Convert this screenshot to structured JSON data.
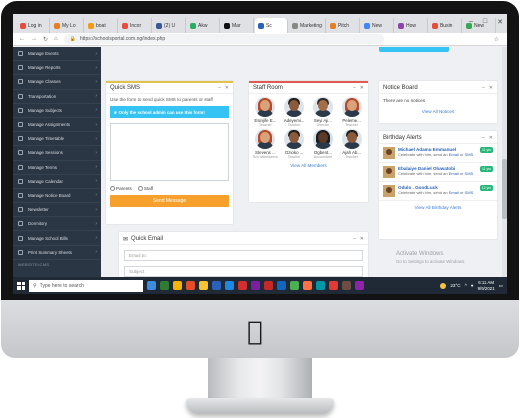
{
  "browser": {
    "tabs": [
      {
        "label": "Log in",
        "color": "#e74c3c"
      },
      {
        "label": "My Lo",
        "color": "#e67e22"
      },
      {
        "label": "boat",
        "color": "#f39c12"
      },
      {
        "label": "Incor",
        "color": "#e74c3c"
      },
      {
        "label": "(2) U",
        "color": "#3b5998"
      },
      {
        "label": "Akw",
        "color": "#27ae60"
      },
      {
        "label": "Mar",
        "color": "#111111"
      },
      {
        "label": "Sc",
        "color": "#2a62b9",
        "active": true
      },
      {
        "label": "Marketing",
        "color": "#888888"
      },
      {
        "label": "Pitch",
        "color": "#e67e22"
      },
      {
        "label": "New",
        "color": "#4285f4"
      },
      {
        "label": "How",
        "color": "#8e44ad"
      },
      {
        "label": "Busin",
        "color": "#e74c3c"
      },
      {
        "label": "New",
        "color": "#34a853"
      }
    ],
    "url": "https://schoolsportal.com.ng/index.php",
    "window_controls": [
      "–",
      "□",
      "✕"
    ],
    "nav_icons": [
      "←",
      "→",
      "↻",
      "⌂"
    ]
  },
  "sidebar": {
    "items": [
      "Manage Events",
      "Manage Reports",
      "Manage Classes",
      "Transportation",
      "Manage Subjects",
      "Manage Assignments",
      "Manage Timetable",
      "Manage Sessions",
      "Manage Terms",
      "Manage Calendar",
      "Manage Notice Board",
      "Newsletter",
      "Dormitory",
      "Manage School Bills",
      "Print Summary Sheets"
    ],
    "section": "WEBSITE/CMS"
  },
  "quick_sms": {
    "title": "Quick SMS",
    "description": "Use the form to send quick SMS to parents or staff",
    "alert": "Only the school admin can use this form!",
    "radio_parents": "Parents",
    "radio_staff": "Staff",
    "send_button": "Send Message"
  },
  "staff_room": {
    "title": "Staff Room",
    "members": [
      {
        "name": "Esinjife E...",
        "role": "Teacher",
        "skin": "#d9a27a",
        "hair": "#b44a2a",
        "gender": "f"
      },
      {
        "name": "Adeyemi...",
        "role": "Teacher",
        "skin": "#8a5a3b",
        "hair": "#1e1e1e",
        "gender": "m"
      },
      {
        "name": "Seyi Aji...",
        "role": "Director",
        "skin": "#a36d48",
        "hair": "#2b2b2b",
        "gender": "m"
      },
      {
        "name": "Peleme...",
        "role": "Teacher",
        "skin": "#d9a27a",
        "hair": "#b44a2a",
        "gender": "f"
      },
      {
        "name": "Stevens ...",
        "role": "Sch Attendance",
        "skin": "#d9a27a",
        "hair": "#b44a2a",
        "gender": "f"
      },
      {
        "name": "Ozioko ...",
        "role": "Teacher",
        "skin": "#8a5a3b",
        "hair": "#1e1e1e",
        "gender": "m"
      },
      {
        "name": "Ogbent...",
        "role": "Accountant",
        "skin": "#5b3a26",
        "hair": "#1a1a1a",
        "gender": "f"
      },
      {
        "name": "Ajah Ab...",
        "role": "Teacher",
        "skin": "#8a5a3b",
        "hair": "#1e1e1e",
        "gender": "m"
      }
    ],
    "view_all": "View All Members"
  },
  "notice_board": {
    "title": "Notice Board",
    "empty_text": "There are no notices",
    "view_all": "View All Notices"
  },
  "birthday_alerts": {
    "title": "Birthday Alerts",
    "entries": [
      {
        "name": "Michael Adamu Emmanuel",
        "badge": "11 yrs",
        "line": "Celebrate with him, send an",
        "email": "Email",
        "or": "or",
        "sms": "SMS"
      },
      {
        "name": "Ebalaiye Daniel Oluwatobi",
        "badge": "11 yrs",
        "line": "Celebrate with him, send an",
        "email": "Email",
        "or": "or",
        "sms": "SMS"
      },
      {
        "name": "Odulo . GoodLuck",
        "badge": "12 yrs",
        "line": "Celebrate with him, send an",
        "email": "Email",
        "or": "or",
        "sms": "SMS"
      }
    ],
    "view_all": "View All Birthday Alerts"
  },
  "quick_email": {
    "title": "Quick Email",
    "email_placeholder": "Email to:",
    "subject_placeholder": "Subject"
  },
  "watermark": {
    "line1": "Activate Windows",
    "line2": "Go to Settings to activate Windows."
  },
  "taskbar": {
    "search_placeholder": "Type here to search",
    "icon_colors": [
      "#3c8dde",
      "#2e7d32",
      "#f4b400",
      "#e44d26",
      "#f7c331",
      "#2a62b9",
      "#1e88e5",
      "#d32f2f",
      "#7b1fa2",
      "#c62828",
      "#1565c0",
      "#4caf50",
      "#ff7043",
      "#0097a7",
      "#e53935",
      "#6d4c41",
      "#8e24aa"
    ],
    "weather": "23°C",
    "time": "6:11 AM",
    "date": "9/9/2021"
  },
  "colors": {
    "sidebar_bg": "#2b3644",
    "accent_panel_border": "#e2c34a",
    "alert_bg": "#35c3f3",
    "send_button": "#f7a12c",
    "badge": "#28b77a",
    "link": "#2a62b9"
  }
}
